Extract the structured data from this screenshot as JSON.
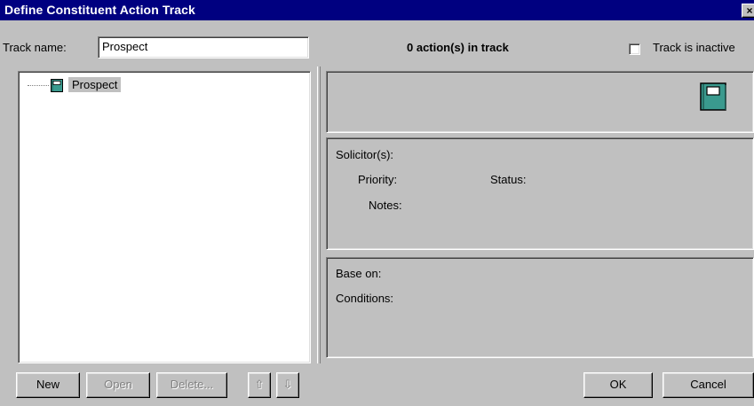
{
  "window": {
    "title": "Define Constituent Action Track",
    "close_glyph": "×"
  },
  "header": {
    "track_name_label": "Track name:",
    "track_name_value": "Prospect",
    "action_count": "0 action(s) in track",
    "inactive_label": "Track is inactive",
    "inactive_checked": false
  },
  "tree": {
    "items": [
      {
        "label": "Prospect",
        "icon": "track-book-icon"
      }
    ]
  },
  "detail": {
    "icon": "track-book-icon",
    "solicitors_label": "Solicitor(s):",
    "priority_label": "Priority:",
    "status_label": "Status:",
    "notes_label": "Notes:",
    "base_on_label": "Base on:",
    "conditions_label": "Conditions:"
  },
  "buttons": {
    "new": "New",
    "open": "Open",
    "delete": "Delete...",
    "move_up": "⇧",
    "move_down": "⇩",
    "ok": "OK",
    "cancel": "Cancel"
  },
  "colors": {
    "titlebar": "#000080",
    "face": "#c0c0c0",
    "icon_teal": "#3a9a8e"
  }
}
